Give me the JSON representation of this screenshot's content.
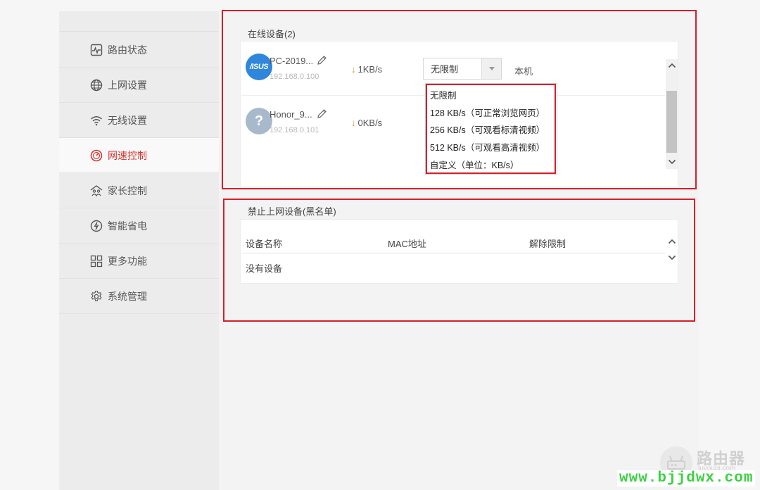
{
  "sidebar": {
    "items": [
      {
        "label": "路由状态",
        "icon": "pulse-chart-icon"
      },
      {
        "label": "上网设置",
        "icon": "globe-icon"
      },
      {
        "label": "无线设置",
        "icon": "wifi-icon"
      },
      {
        "label": "网速控制",
        "icon": "speedometer-icon",
        "active": true
      },
      {
        "label": "家长控制",
        "icon": "parental-home-icon"
      },
      {
        "label": "智能省电",
        "icon": "power-save-icon"
      },
      {
        "label": "更多功能",
        "icon": "grid-apps-icon"
      },
      {
        "label": "系统管理",
        "icon": "gear-icon"
      }
    ]
  },
  "online": {
    "title": "在线设备(2)",
    "devices": [
      {
        "name": "PC-2019...",
        "ip": "192.168.0.100",
        "speed": "1KB/s",
        "avatar": "asus-logo",
        "avatar_text": "/ISUS",
        "limit": "无限制",
        "tag": "本机"
      },
      {
        "name": "Honor_9...",
        "ip": "192.168.0.101",
        "speed": "0KB/s",
        "avatar": "question-mark",
        "avatar_text": "?"
      }
    ],
    "speed_arrow": "↓",
    "dropdown_options": [
      "无限制",
      "128 KB/s（可正常浏览网页）",
      "256 KB/s（可观看标清视频）",
      "512 KB/s（可观看高清视频）",
      "自定义（单位：KB/s）"
    ]
  },
  "blacklist": {
    "title": "禁止上网设备(黑名单)",
    "columns": [
      "设备名称",
      "MAC地址",
      "解除限制"
    ],
    "empty_text": "没有设备"
  },
  "watermark": {
    "brand": "路由器",
    "sub": "luyouqi.com",
    "url": "www.bjjdwx.com"
  },
  "colors": {
    "accent": "#d6322e",
    "highlight_box": "#d51f2a",
    "watermark_url": "#3bd142"
  }
}
